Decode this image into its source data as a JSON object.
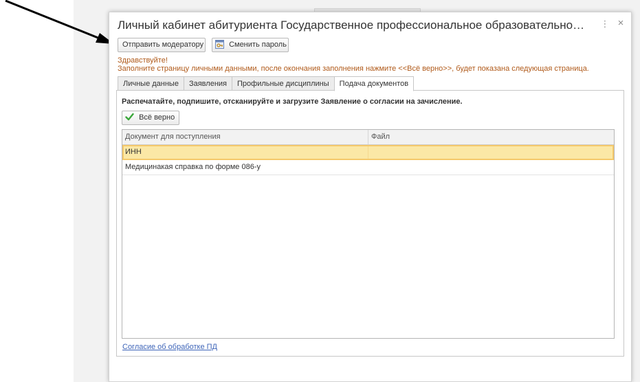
{
  "window": {
    "title": "Личный кабинет абитуриента Государственное профессиональное образовательное автономное уч...",
    "more_glyph": "⋮",
    "close_glyph": "×"
  },
  "toolbar": {
    "send_to_moderator_label": "Отправить модератору",
    "change_password_label": "Сменить пароль",
    "change_password_icon": "key-window-icon"
  },
  "greeting": {
    "line1": "Здравствуйте!",
    "line2": "Заполните страницу личными данными, после окончания заполнения нажмите <<Всё верно>>, будет показана следующая страница."
  },
  "tabs": [
    {
      "label": "Личные данные",
      "active": false
    },
    {
      "label": "Заявления",
      "active": false
    },
    {
      "label": "Профильные дисциплины",
      "active": false
    },
    {
      "label": "Подача документов",
      "active": true
    }
  ],
  "documents_tab": {
    "instruction": "Распечатайте, подпишите, отсканируйте и загрузите Заявление о согласии на зачисление.",
    "ok_button_label": "Всё верно",
    "ok_button_icon": "checkmark-icon",
    "table": {
      "columns": [
        "Документ для поступления",
        "Файл"
      ],
      "rows": [
        {
          "document": "ИНН",
          "file": "",
          "selected": true
        },
        {
          "document": "Медицинакая справка по форме 086-у",
          "file": "",
          "selected": false
        }
      ]
    },
    "consent_link": "Согласие об обработке ПД"
  },
  "colors": {
    "greeting_text": "#b05a1a",
    "selected_row_bg": "#fbe8a6",
    "selected_row_border": "#f5c96a",
    "link": "#3d64b8",
    "check_icon": "#3aa73a"
  }
}
